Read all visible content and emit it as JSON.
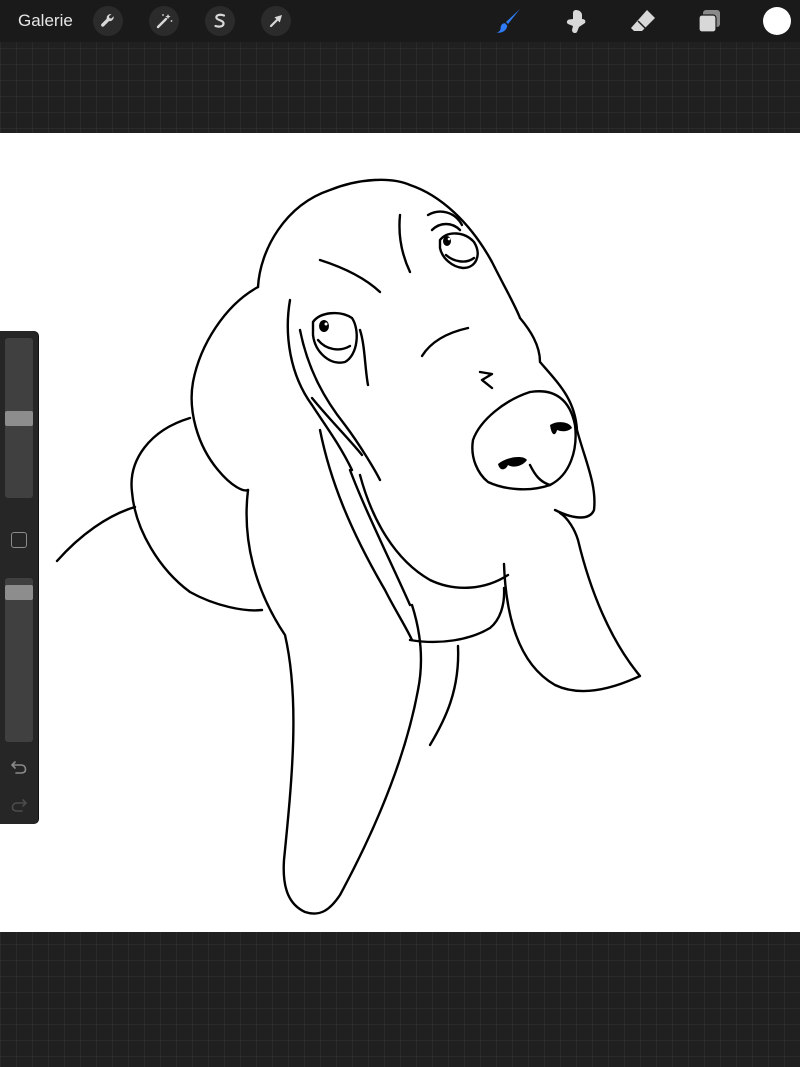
{
  "toolbar": {
    "gallery_label": "Galerie",
    "left_tools": [
      {
        "name": "wrench-icon",
        "purpose": "actions"
      },
      {
        "name": "magic-wand-icon",
        "purpose": "adjustments"
      },
      {
        "name": "selection-s-icon",
        "purpose": "selection"
      },
      {
        "name": "arrow-cursor-icon",
        "purpose": "transform"
      }
    ],
    "right_tools": [
      {
        "name": "brush-icon",
        "purpose": "paint",
        "active": true
      },
      {
        "name": "smudge-icon",
        "purpose": "smudge",
        "active": false
      },
      {
        "name": "eraser-icon",
        "purpose": "erase",
        "active": false
      },
      {
        "name": "layers-icon",
        "purpose": "layers",
        "active": false
      }
    ],
    "current_color": "#ffffff"
  },
  "sidebar": {
    "brush_size_level": 0.5,
    "opacity_level": 0.95,
    "modify_icon": "square-icon",
    "undo_icon": "undo-icon",
    "redo_icon": "redo-icon"
  },
  "canvas": {
    "background_color": "#ffffff",
    "artwork": "basset-hound-line-drawing"
  },
  "colors": {
    "active_tool": "#2f7cf6",
    "icon_default": "#d8d8d8",
    "toolbar_bg": "#1a1a1a"
  }
}
